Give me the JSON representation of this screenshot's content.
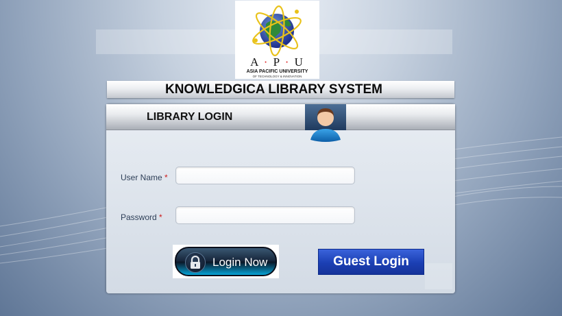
{
  "logo": {
    "letters": [
      "A",
      "P",
      "U"
    ],
    "line1": "ASIA PACIFIC UNIVERSITY",
    "line2": "OF TECHNOLOGY & INNOVATION"
  },
  "header": {
    "title": "KNOWLEDGICA LIBRARY SYSTEM"
  },
  "panel": {
    "title": "LIBRARY LOGIN",
    "avatar_icon": "user-avatar-icon"
  },
  "form": {
    "username": {
      "label": "User Name",
      "required_mark": "*",
      "value": "",
      "placeholder": ""
    },
    "password": {
      "label": "Password",
      "required_mark": "*",
      "value": "",
      "placeholder": ""
    }
  },
  "buttons": {
    "login": {
      "label": "Login Now",
      "icon": "lock-icon"
    },
    "guest": {
      "label": "Guest Login"
    }
  },
  "colors": {
    "accent": "#1b3fb3",
    "required": "#cc1a1a",
    "label": "#2d3e57"
  }
}
